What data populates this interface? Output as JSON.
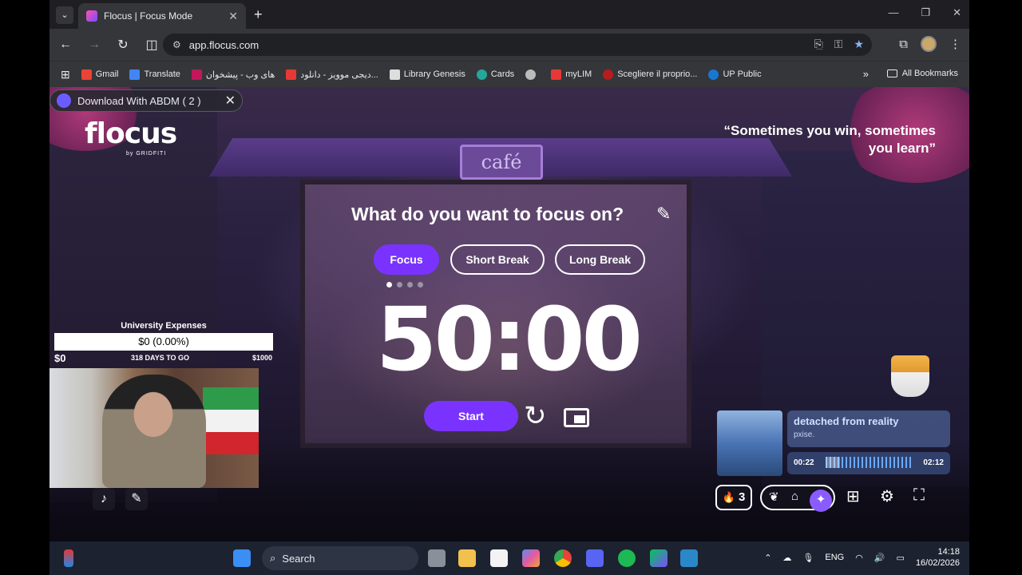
{
  "browser": {
    "tab_title": "Flocus | Focus Mode",
    "url": "app.flocus.com",
    "bookmarks": [
      "Gmail",
      "Translate",
      "های وب - پیشخوان",
      "دیجی موویز - دانلود...",
      "Library Genesis",
      "Cards",
      "",
      "myLIM",
      "Scegliere il proprio...",
      "UP Public"
    ],
    "all_bookmarks": "All Bookmarks"
  },
  "extension_banner": {
    "label": "Download With ABDM ( 2 )"
  },
  "app": {
    "logo": "flocus",
    "logo_sub": "by GRIDFITI",
    "quote": "“Sometimes you win, sometimes you learn”",
    "question": "What do you want to focus on?",
    "modes": [
      {
        "label": "Focus",
        "active": true
      },
      {
        "label": "Short Break",
        "active": false
      },
      {
        "label": "Long Break",
        "active": false
      }
    ],
    "timer": "50:00",
    "start_label": "Start",
    "session_dots": 4,
    "current_session": 1
  },
  "goal": {
    "title": "University Expenses",
    "progress_text": "$0 (0.00%)",
    "min": "$0",
    "days": "318 DAYS TO GO",
    "max": "$1000",
    "progress_fraction": 0.0
  },
  "music": {
    "title": "detached from reality",
    "artist": "pxise.",
    "elapsed": "00:22",
    "total": "02:12",
    "progress_fraction": 0.17
  },
  "streak": {
    "count": "3"
  },
  "taskbar": {
    "search_placeholder": "Search",
    "lang": "ENG",
    "time": "14:18",
    "date": "16/02/2026"
  },
  "colors": {
    "accent": "#7a33ff",
    "chrome_bg": "#35363a",
    "taskbar_bg": "#1c2230"
  }
}
